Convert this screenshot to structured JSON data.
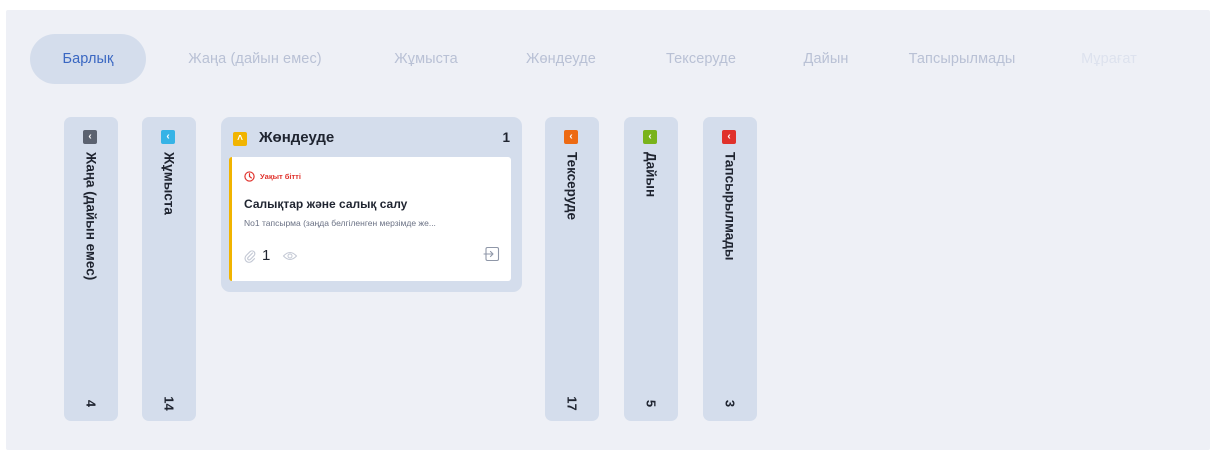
{
  "tabs": [
    {
      "label": "Барлық"
    },
    {
      "label": "Жаңа (дайын емес)"
    },
    {
      "label": "Жұмыста"
    },
    {
      "label": "Жөндеуде"
    },
    {
      "label": "Тексеруде"
    },
    {
      "label": "Дайын"
    },
    {
      "label": "Тапсырылмады"
    },
    {
      "label": "Мұрағат"
    }
  ],
  "active_tab": "Барлық",
  "columns": [
    {
      "title": "Жаңа (дайын емес)",
      "count": "4",
      "color": "#5b6270",
      "state": "collapsed"
    },
    {
      "title": "Жұмыста",
      "count": "14",
      "color": "#36b3e6",
      "state": "collapsed"
    },
    {
      "title": "Жөндеуде",
      "count": "1",
      "color": "#f1b400",
      "state": "expanded"
    },
    {
      "title": "Тексеруде",
      "count": "17",
      "color": "#ed6a13",
      "state": "collapsed"
    },
    {
      "title": "Дайын",
      "count": "5",
      "color": "#79b31b",
      "state": "collapsed"
    },
    {
      "title": "Тапсырылмады",
      "count": "3",
      "color": "#e0312b",
      "state": "collapsed"
    }
  ],
  "card": {
    "status": "Уақыт бітті",
    "title": "Салықтар және салық салу",
    "description": "No1 тапсырма (заңда белгіленген мерзімде же...",
    "attachments": "1",
    "accent_color": "#f1b400",
    "status_color": "#e0312b"
  },
  "icons": {
    "collapsed_toggle": "chevron-left-icon",
    "expanded_toggle": "chevron-up-icon",
    "card_status": "clock-icon",
    "card_attachment": "paperclip-icon",
    "card_views": "eye-icon",
    "card_open": "enter-icon"
  }
}
